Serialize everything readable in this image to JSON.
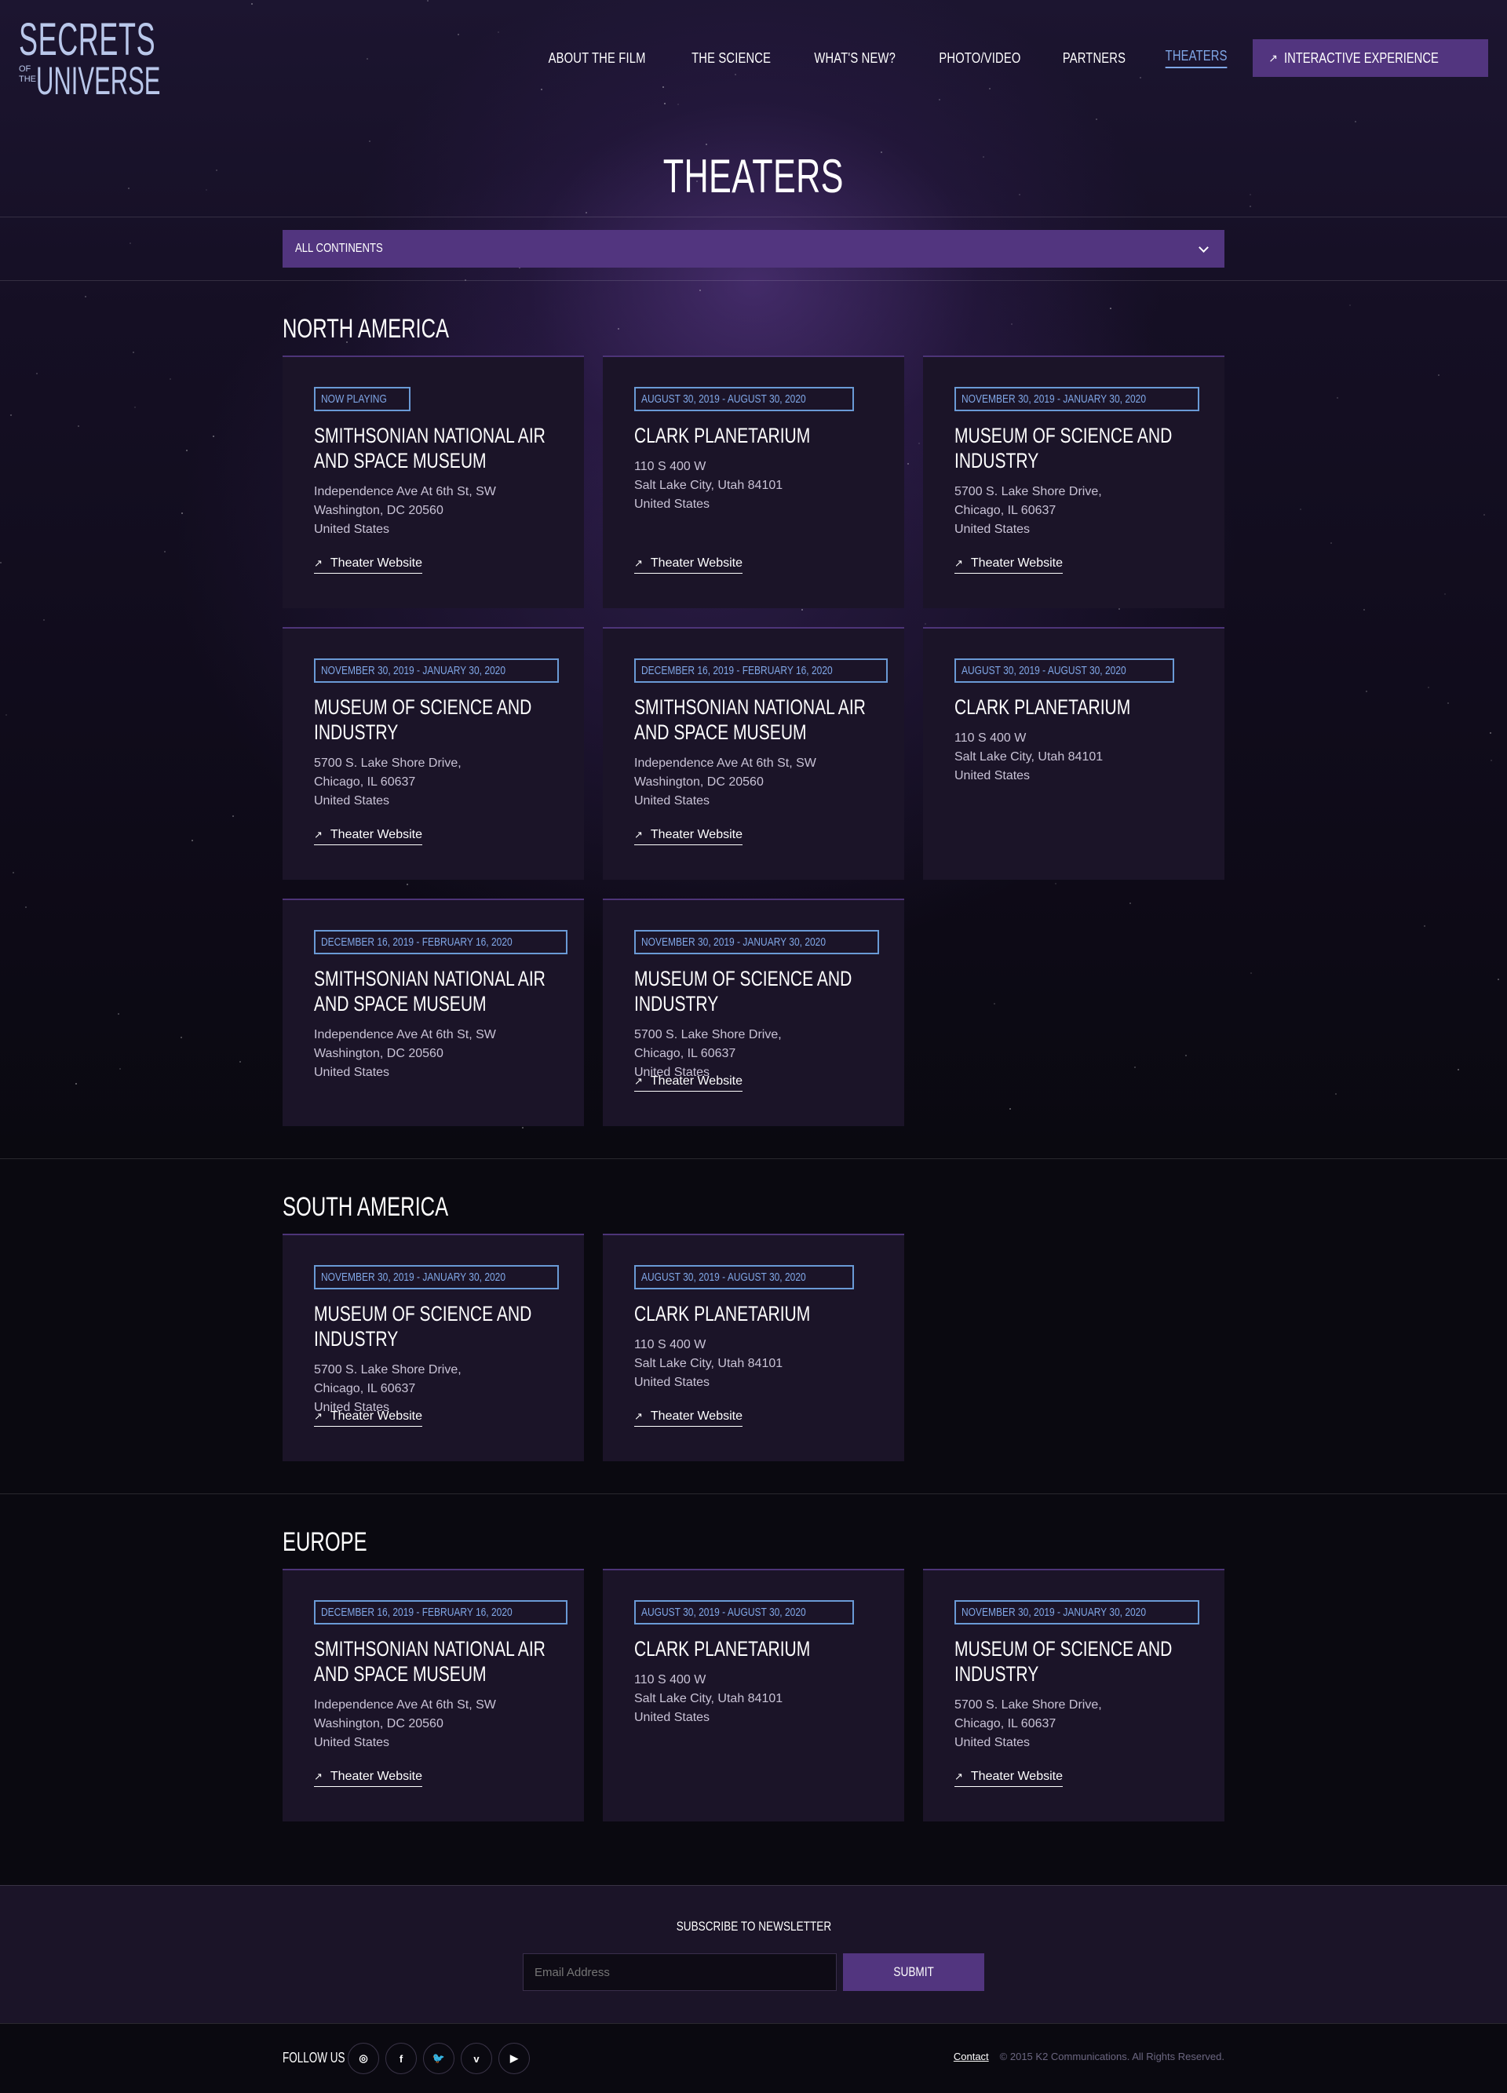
{
  "header": {
    "logo": {
      "line1": "SECRETS",
      "of": "OF",
      "the": "THE",
      "line2": "UNIVERSE"
    },
    "nav": [
      {
        "label": "ABOUT THE FILM",
        "active": false
      },
      {
        "label": "THE SCIENCE",
        "active": false
      },
      {
        "label": "WHAT'S NEW?",
        "active": false
      },
      {
        "label": "PHOTO/VIDEO",
        "active": false
      },
      {
        "label": "PARTNERS",
        "active": false
      },
      {
        "label": "THEATERS",
        "active": true
      }
    ],
    "cta_label": "INTERACTIVE EXPERIENCE"
  },
  "page_title": "THEATERS",
  "filter": {
    "selected": "ALL CONTINENTS"
  },
  "link_label": "Theater Website",
  "sections": [
    {
      "title": "NORTH AMERICA",
      "cards": [
        {
          "badge": "NOW PLAYING",
          "name": "SMITHSONIAN NATIONAL AIR AND SPACE MUSEUM",
          "addr1": "Independence Ave At 6th St, SW",
          "addr2": "Washington, DC 20560",
          "addr3": "United States",
          "link": true
        },
        {
          "badge": "AUGUST 30, 2019 - AUGUST 30, 2020",
          "name": "CLARK PLANETARIUM",
          "addr1": "110 S 400 W",
          "addr2": "Salt Lake City, Utah 84101",
          "addr3": "United States",
          "link": true
        },
        {
          "badge": "NOVEMBER 30, 2019 - JANUARY 30, 2020",
          "name": "MUSEUM OF SCIENCE AND INDUSTRY",
          "addr1": "5700 S. Lake Shore Drive,",
          "addr2": "Chicago, IL 60637",
          "addr3": "United States",
          "link": true
        },
        {
          "badge": "NOVEMBER 30, 2019 - JANUARY 30, 2020",
          "name": "MUSEUM OF SCIENCE AND INDUSTRY",
          "addr1": "5700 S. Lake Shore Drive,",
          "addr2": "Chicago, IL 60637",
          "addr3": "United States",
          "link": true
        },
        {
          "badge": "DECEMBER 16, 2019 - FEBRUARY 16, 2020",
          "name": "SMITHSONIAN NATIONAL AIR AND SPACE MUSEUM",
          "addr1": "Independence Ave At 6th St, SW",
          "addr2": "Washington, DC 20560",
          "addr3": "United States",
          "link": true
        },
        {
          "badge": "AUGUST 30, 2019 - AUGUST 30, 2020",
          "name": "CLARK PLANETARIUM",
          "addr1": "110 S 400 W",
          "addr2": "Salt Lake City, Utah 84101",
          "addr3": "United States",
          "link": false
        },
        {
          "badge": "DECEMBER 16, 2019 - FEBRUARY 16, 2020",
          "name": "SMITHSONIAN NATIONAL AIR AND SPACE MUSEUM",
          "addr1": "Independence Ave At 6th St, SW",
          "addr2": "Washington, DC 20560",
          "addr3": "United States",
          "link": false
        },
        {
          "badge": "NOVEMBER 30, 2019 - JANUARY 30, 2020",
          "name": "MUSEUM OF SCIENCE AND INDUSTRY",
          "addr1": "5700 S. Lake Shore Drive,",
          "addr2": "Chicago, IL 60637",
          "addr3": "United States",
          "link": true
        }
      ]
    },
    {
      "title": "SOUTH AMERICA",
      "cards": [
        {
          "badge": "NOVEMBER 30, 2019 - JANUARY 30, 2020",
          "name": "MUSEUM OF SCIENCE AND INDUSTRY",
          "addr1": "5700 S. Lake Shore Drive,",
          "addr2": "Chicago, IL 60637",
          "addr3": "United States",
          "link": true
        },
        {
          "badge": "AUGUST 30, 2019 - AUGUST 30, 2020",
          "name": "CLARK PLANETARIUM",
          "addr1": "110 S 400 W",
          "addr2": "Salt Lake City, Utah 84101",
          "addr3": "United States",
          "link": true
        }
      ]
    },
    {
      "title": "EUROPE",
      "cards": [
        {
          "badge": "DECEMBER 16, 2019 - FEBRUARY 16, 2020",
          "name": "SMITHSONIAN NATIONAL AIR AND SPACE MUSEUM",
          "addr1": "Independence Ave At 6th St, SW",
          "addr2": "Washington, DC 20560",
          "addr3": "United States",
          "link": true
        },
        {
          "badge": "AUGUST 30, 2019 - AUGUST 30, 2020",
          "name": "CLARK PLANETARIUM",
          "addr1": "110 S 400 W",
          "addr2": "Salt Lake City, Utah 84101",
          "addr3": "United States",
          "link": false
        },
        {
          "badge": "NOVEMBER 30, 2019 - JANUARY 30, 2020",
          "name": "MUSEUM OF SCIENCE AND INDUSTRY",
          "addr1": "5700 S. Lake Shore Drive,",
          "addr2": "Chicago, IL 60637",
          "addr3": "United States",
          "link": true
        }
      ]
    }
  ],
  "newsletter": {
    "title": "SUBSCRIBE TO NEWSLETTER",
    "placeholder": "Email Address",
    "submit": "SUBMIT"
  },
  "footer": {
    "follow": "FOLLOW US",
    "socials": [
      {
        "icon": "instagram-icon",
        "glyph": "◎"
      },
      {
        "icon": "facebook-icon",
        "glyph": "f"
      },
      {
        "icon": "twitter-icon",
        "glyph": "🐦"
      },
      {
        "icon": "vimeo-icon",
        "glyph": "v"
      },
      {
        "icon": "youtube-icon",
        "glyph": "▶"
      }
    ],
    "contact": "Contact",
    "copyright": "© 2015 K2 Communications. All Rights Reserved."
  },
  "colors": {
    "accent": "#52357f",
    "badge": "#7fa6e6",
    "card": "#1b1428"
  }
}
